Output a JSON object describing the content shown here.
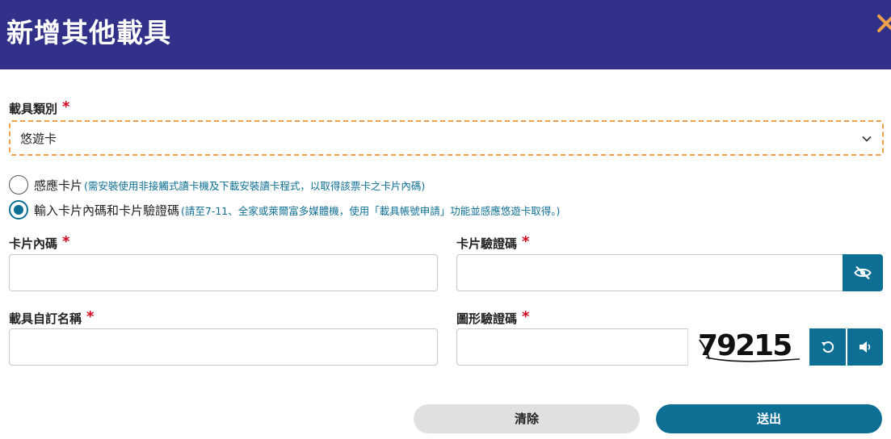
{
  "dialog": {
    "title": "新增其他載具"
  },
  "carrier_type": {
    "label": "載具類別",
    "required_mark": "*",
    "selected_value": "悠遊卡"
  },
  "options": [
    {
      "label": "感應卡片",
      "hint": "(需安裝使用非接觸式讀卡機及下載安裝讀卡程式，以取得該票卡之卡片內碼)",
      "checked": false
    },
    {
      "label": "輸入卡片內碼和卡片驗證碼",
      "hint": "(請至7-11、全家或萊爾富多媒體機，使用「載具帳號申請」功能並感應悠遊卡取得。)",
      "checked": true
    }
  ],
  "fields": {
    "card_internal_code": {
      "label": "卡片內碼",
      "required_mark": "*",
      "value": ""
    },
    "card_verify_code": {
      "label": "卡片驗證碼",
      "required_mark": "*",
      "value": ""
    },
    "carrier_name": {
      "label": "載具自訂名稱",
      "required_mark": "*",
      "value": ""
    },
    "captcha": {
      "label": "圖形驗證碼",
      "required_mark": "*",
      "value": "",
      "image_text": "79215"
    }
  },
  "buttons": {
    "clear": "清除",
    "submit": "送出"
  },
  "colors": {
    "header_bg": "#31318a",
    "accent": "#0e6f94",
    "close_icon": "#f0a04b",
    "focus_border": "#f0a04b",
    "required": "#d0021b"
  },
  "icons": {
    "close": "close-icon",
    "chevron": "chevron-down-icon",
    "eye": "eye-off-icon",
    "refresh": "refresh-icon",
    "audio": "speaker-icon"
  }
}
